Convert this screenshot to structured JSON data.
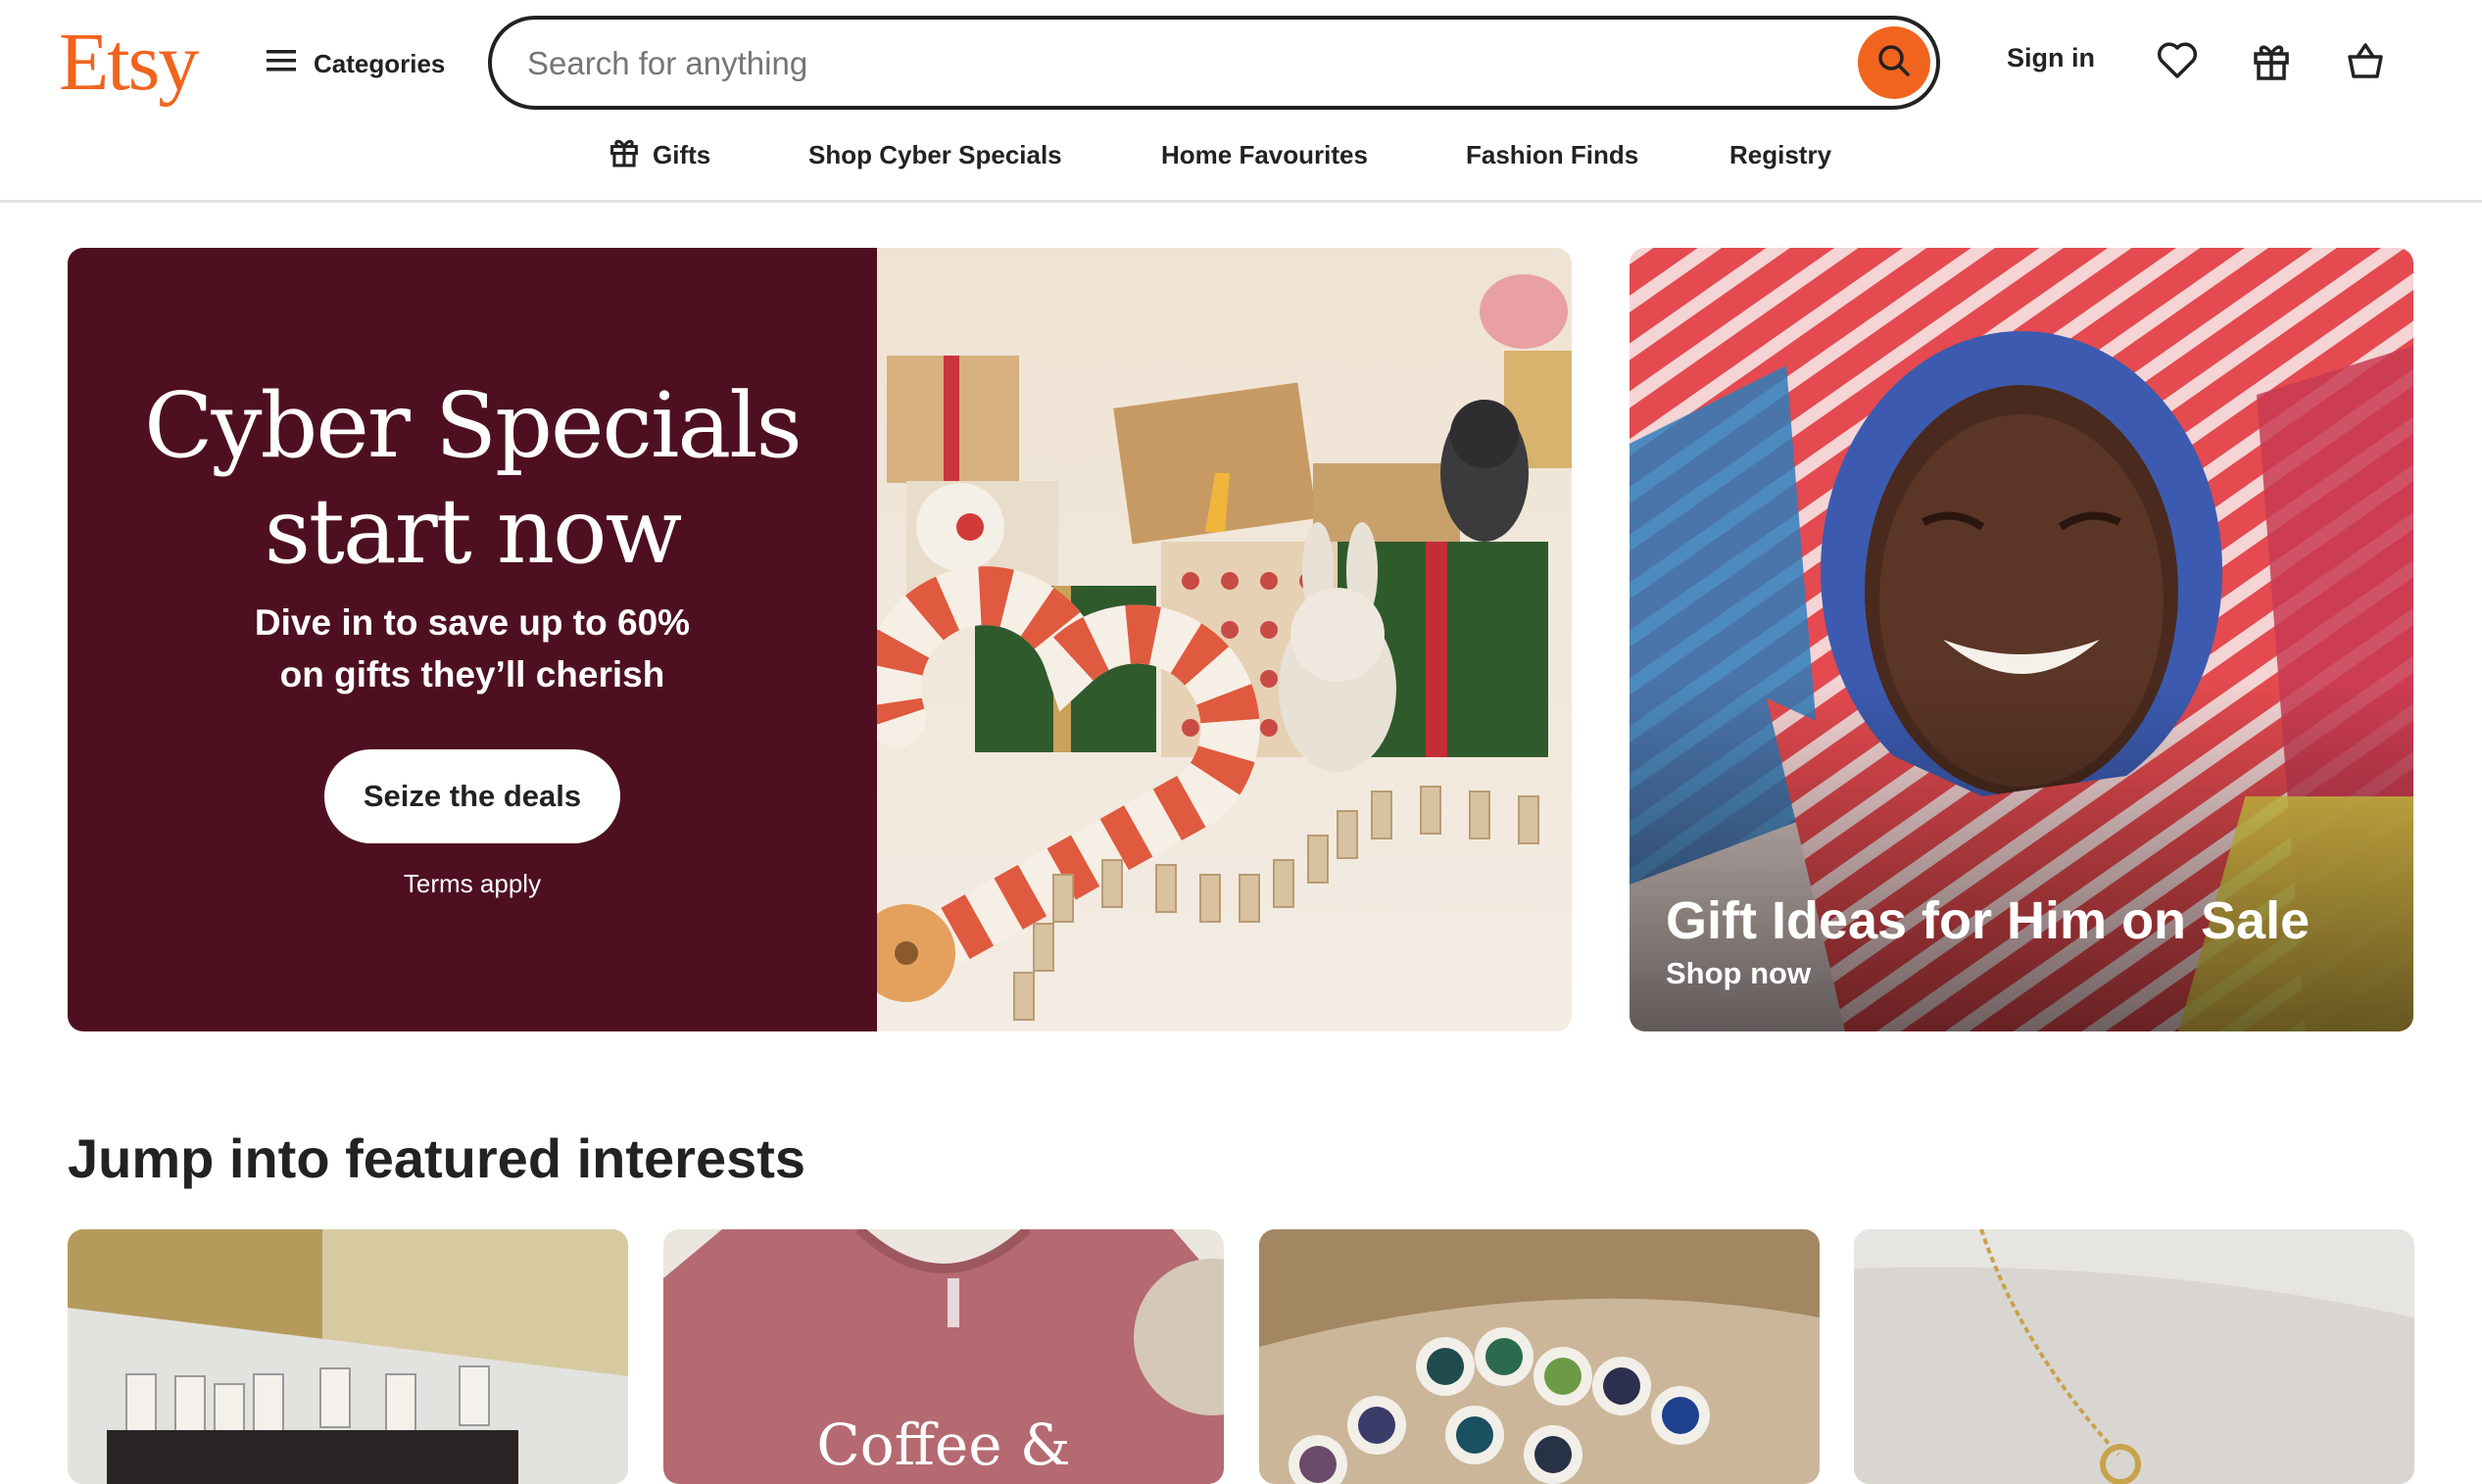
{
  "header": {
    "logo": "Etsy",
    "categories_label": "Categories",
    "search_placeholder": "Search for anything",
    "signin_label": "Sign in"
  },
  "nav": {
    "items": [
      "Gifts",
      "Shop Cyber Specials",
      "Home Favourites",
      "Fashion Finds",
      "Registry"
    ]
  },
  "hero": {
    "title": "Cyber Specials\nstart now",
    "subtitle": "Dive in to save up to 60%\non gifts they’ll cherish",
    "button_label": "Seize the deals",
    "terms": "Terms apply"
  },
  "side_promo": {
    "title": "Gift Ideas for Him on Sale",
    "link": "Shop now"
  },
  "interests": {
    "title": "Jump into featured interests",
    "cards": [
      {
        "shirt_text": ""
      },
      {
        "shirt_text": "Coffee &"
      },
      {
        "shirt_text": ""
      },
      {
        "shirt_text": ""
      }
    ]
  },
  "colors": {
    "brand": "#f1641e",
    "promo_bg": "#4e1021",
    "text": "#222222"
  },
  "icons": [
    "hamburger-icon",
    "search-icon",
    "heart-icon",
    "gift-icon",
    "basket-icon"
  ]
}
